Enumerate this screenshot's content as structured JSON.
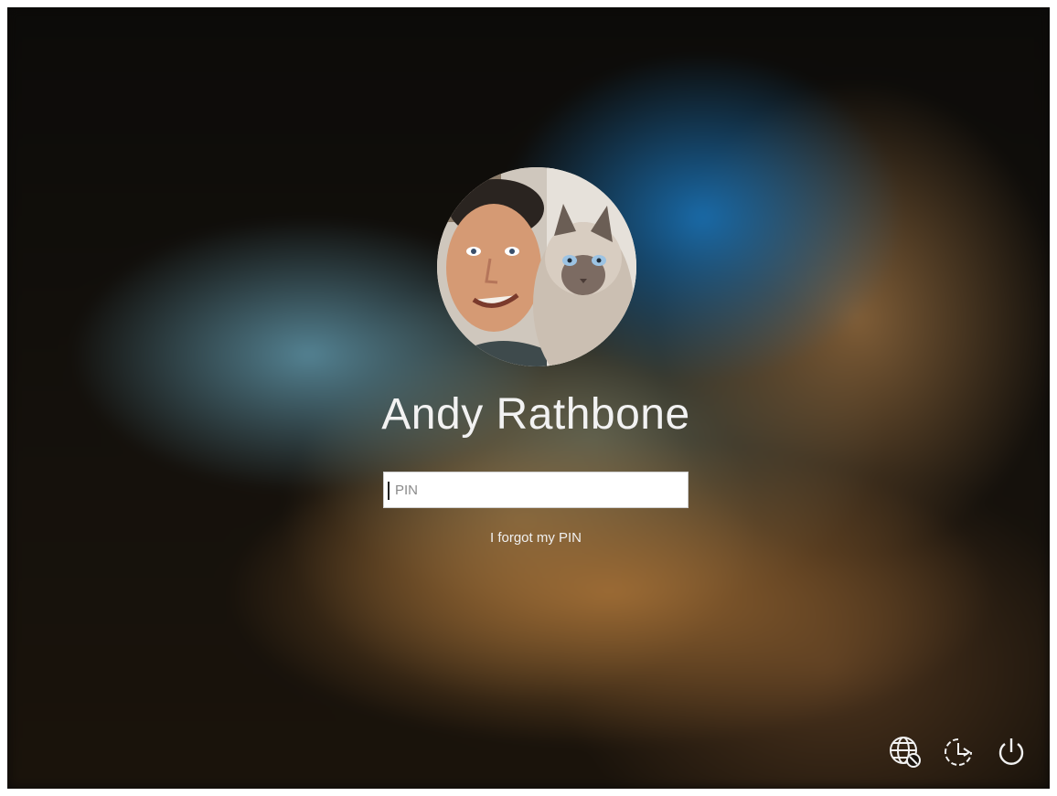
{
  "user": {
    "name": "Andy Rathbone"
  },
  "pin_field": {
    "placeholder": "PIN",
    "value": ""
  },
  "links": {
    "forgot_pin": "I forgot my PIN"
  },
  "tray_icons": [
    "network-icon",
    "ease-of-access-icon",
    "power-icon"
  ],
  "colors": {
    "text": "#f2f2f2",
    "input_bg": "#ffffff"
  }
}
